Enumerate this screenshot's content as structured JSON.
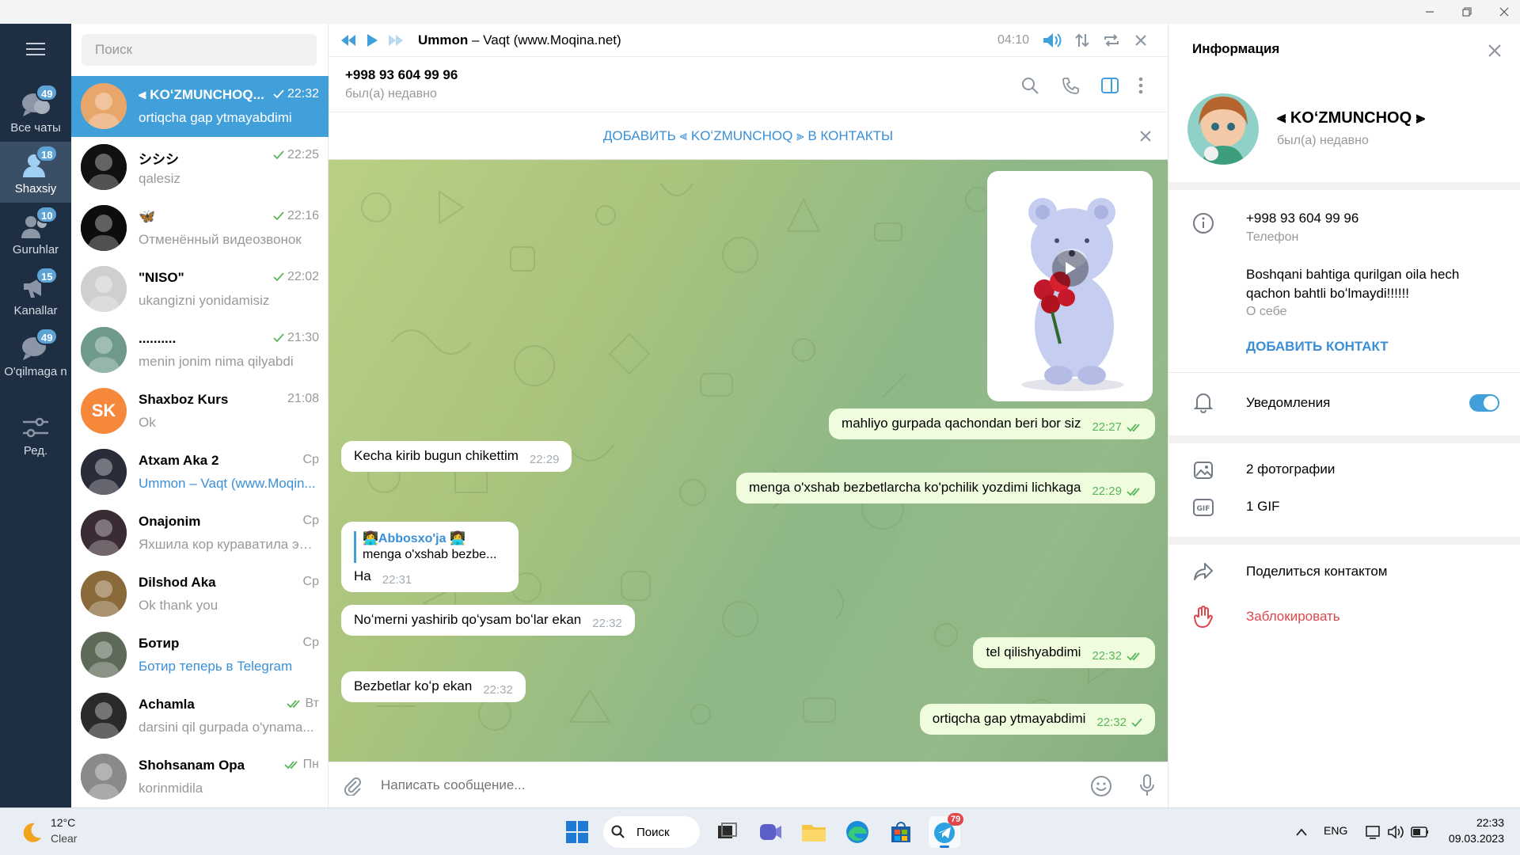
{
  "window": {
    "controls": [
      "minimize",
      "maximize",
      "close"
    ]
  },
  "folders": [
    {
      "label": "Все чаты",
      "badge": "49",
      "icon": "chats-icon"
    },
    {
      "label": "Shaxsiy",
      "badge": "18",
      "icon": "person-icon",
      "active": true
    },
    {
      "label": "Guruhlar",
      "badge": "10",
      "icon": "group-icon"
    },
    {
      "label": "Kanallar",
      "badge": "15",
      "icon": "channel-icon"
    },
    {
      "label": "O'qilmaga n",
      "badge": "49",
      "icon": "unread-icon"
    },
    {
      "label": "Ред.",
      "icon": "edit-folders-icon"
    }
  ],
  "search": {
    "placeholder": "Поиск"
  },
  "chats": [
    {
      "name": "⫷ KOʻZMUNCHOQ...",
      "time": "22:32",
      "msg": "ortiqcha gap ytmayabdimi",
      "check": "single",
      "selected": true,
      "avatar": "#e9a66b"
    },
    {
      "name": "シシシ",
      "time": "22:25",
      "msg": "qalesiz",
      "check": "single",
      "avatar": "#111111"
    },
    {
      "name": "🦋",
      "time": "22:16",
      "msg": "Отменённый видеозвонок",
      "check": "single",
      "avatar": "#0d0d0d"
    },
    {
      "name": "\"NISO\"",
      "time": "22:02",
      "msg": "ukangizni yonidamisiz",
      "check": "single",
      "avatar": "#cfcfcf"
    },
    {
      "name": "..........",
      "time": "21:30",
      "msg": "menin jonim nima qilyabdi",
      "check": "single",
      "avatar": "#6f9a8a"
    },
    {
      "name": "Shaxboz Kurs",
      "time": "21:08",
      "msg": "Ok",
      "initials": "SK",
      "avatar": "#f5883a"
    },
    {
      "name": "Atxam Aka 2",
      "time": "Ср",
      "msg": "Ummon – Vaqt (www.Moqin...",
      "link": true,
      "avatar": "#2a2c3a"
    },
    {
      "name": "Onajonim",
      "time": "Ср",
      "msg": "Яхшила кор куравaтила эрт...",
      "avatar": "#3a2b34"
    },
    {
      "name": "Dilshod Aka",
      "time": "Ср",
      "msg": "Ok thank you",
      "avatar": "#8a6a3a"
    },
    {
      "name": "Ботир",
      "time": "Ср",
      "msg": "Ботир теперь в Telegram",
      "link": true,
      "avatar": "#5d6a58"
    },
    {
      "name": "Achamla",
      "time": "Вт",
      "msg": "darsini qil gurpada o'ynama...",
      "check": "double",
      "avatar": "#2a2a2a"
    },
    {
      "name": "Shohsanam Opa",
      "time": "Пн",
      "msg": "korinmidila",
      "check": "double",
      "avatar": "#8a8a8a"
    }
  ],
  "player": {
    "artist": "Ummon",
    "title": " – Vaqt (www.Moqina.net)",
    "time": "04:10"
  },
  "chat_header": {
    "phone": "+998 93 604 99 96",
    "status": "был(а) недавно"
  },
  "add_contact_bar": {
    "label": "ДОБАВИТЬ ⫷ KOʻZMUNCHOQ ⫸ В КОНТАКТЫ"
  },
  "messages": [
    {
      "dir": "out",
      "text": "mahliyo gurpada qachondan beri bor siz",
      "time": "22:27",
      "check": "double"
    },
    {
      "dir": "in",
      "text": "Kecha kirib bugun chikettim",
      "time": "22:29"
    },
    {
      "dir": "out",
      "text": "menga o'xshab bezbetlarcha ko'pchilik yozdimi lichkaga",
      "time": "22:29",
      "check": "double"
    },
    {
      "dir": "in",
      "reply_name": "👩‍💻Abbosxo'ja 👩‍💻",
      "reply_text": "menga o'xshab bezbe...",
      "text": "Ha",
      "time": "22:31"
    },
    {
      "dir": "in",
      "text": "Noʻmerni yashirib qoʻysam boʻlar ekan",
      "time": "22:32"
    },
    {
      "dir": "out",
      "text": "tel qilishyabdimi",
      "time": "22:32",
      "check": "double"
    },
    {
      "dir": "in",
      "text": "Bezbetlar koʻp ekan",
      "time": "22:32"
    },
    {
      "dir": "out",
      "text": "ortiqcha gap ytmayabdimi",
      "time": "22:32",
      "check": "single"
    }
  ],
  "composer": {
    "placeholder": "Написать сообщение..."
  },
  "info_panel": {
    "title": "Информация",
    "name": "⫷ KOʻZMUNCHOQ ⫸",
    "status": "был(а) недавно",
    "phone": "+998 93 604 99 96",
    "phone_label": "Телефон",
    "bio": "Boshqani bahtiga qurilgan oila hech qachon bahtli boʻlmaydi!!!!!!",
    "bio_label": "О себе",
    "add_contact": "ДОБАВИТЬ КОНТАКТ",
    "notifications": "Уведомления",
    "notifications_on": true,
    "photos": "2 фотографии",
    "gifs": "1 GIF",
    "share": "Поделиться контактом",
    "block": "Заблокировать"
  },
  "taskbar": {
    "weather_temp": "12°C",
    "weather_text": "Clear",
    "search_label": "Поиск",
    "telegram_badge": "79",
    "lang": "ENG",
    "time": "22:33",
    "date": "09.03.2023"
  },
  "colors": {
    "accent": "#419fd9",
    "rail": "#1f2f43",
    "outgoing": "#effdde",
    "danger": "#e0464b",
    "check": "#5bb55d"
  }
}
